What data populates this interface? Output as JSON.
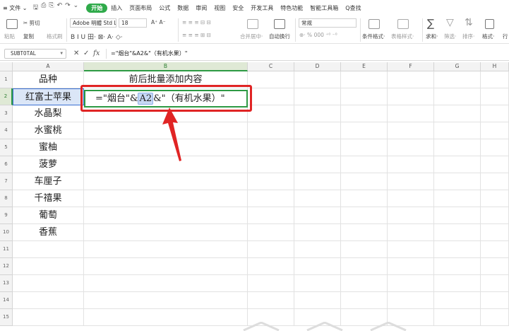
{
  "menubar": {
    "file": "≡ 文件 ⌄",
    "quick_access": [
      "🖫",
      "⎙",
      "⎘",
      "↶",
      "↷",
      "⌄"
    ],
    "start": "开始",
    "tabs": [
      "插入",
      "页面布局",
      "公式",
      "数据",
      "审阅",
      "视图",
      "安全",
      "开发工具",
      "特色功能",
      "智能工具箱"
    ],
    "search": "Q查找"
  },
  "ribbon": {
    "paste": "粘贴",
    "cut": "✂ 剪切",
    "copy": "复制",
    "format_painter": "格式刷",
    "font_name": "Adobe 明體 Std L",
    "font_size": "18",
    "font_grow": "A⁺ A⁻",
    "font_styles": "B  I  U  田·  ⊠·  A·  ◇·",
    "align_row1": "≡ ≡ ≡ ⊟ ⊟",
    "align_row2": "≡ ≡ ≡ ⊞ ⊟",
    "merge": "合并居中·",
    "wrap": "自动换行",
    "number_format": "常规",
    "number_buttons": "⊕· %  000  ⁺⁰ ⁻⁰",
    "cond_format": "条件格式·",
    "table_style": "表格样式·",
    "sum": "求和·",
    "filter": "筛选·",
    "sort": "排序·",
    "format": "格式·",
    "rowcol": "行"
  },
  "formula_bar": {
    "name_box": "SUBTOTAL",
    "cancel": "✕",
    "confirm": "✓",
    "fx": "fx",
    "formula": "=\"烟台\"&A2&\"（有机水果）\""
  },
  "columns": [
    "A",
    "B",
    "C",
    "D",
    "E",
    "F",
    "G",
    "H"
  ],
  "rows": [
    "1",
    "2",
    "3",
    "4",
    "5",
    "6",
    "7",
    "8",
    "9",
    "10",
    "11",
    "12",
    "13",
    "14",
    "15"
  ],
  "cells": {
    "A1": "品种",
    "B1": "前后批量添加内容",
    "A2": "红富士苹果",
    "A3": "水晶梨",
    "A4": "水蜜桃",
    "A5": "蜜柚",
    "A6": "菠萝",
    "A7": "车厘子",
    "A8": "千禧果",
    "A9": "葡萄",
    "A10": "香蕉"
  },
  "edit_cell": {
    "prefix": "=\"烟台\"&",
    "ref": "A2",
    "suffix": "&\"（有机水果）\""
  },
  "colors": {
    "accent_green": "#2faa4a",
    "annotation_red": "#e02424",
    "selection_blue": "#dbe6f7"
  }
}
